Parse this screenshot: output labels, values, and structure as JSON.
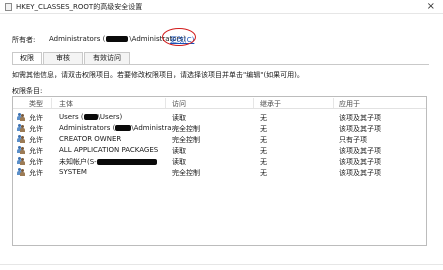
{
  "window": {
    "title": "HKEY_CLASSES_ROOT的高级安全设置",
    "close_glyph": "×"
  },
  "owner": {
    "label": "所有者:",
    "value_prefix": "Administrators (",
    "value_suffix": "\\Administrators)",
    "change_link": "更改(C)"
  },
  "tabs": [
    {
      "label": "权限",
      "active": true
    },
    {
      "label": "审核",
      "active": false
    },
    {
      "label": "有效访问",
      "active": false
    }
  ],
  "info_text": "如需其他信息，请双击权限项目。若要修改权限项目，请选择该项目并单击\"编辑\"(如果可用)。",
  "entries_label": "权限条目:",
  "columns": {
    "type": "类型",
    "principal": "主体",
    "access": "访问",
    "inherited_from": "继承于",
    "applies_to": "应用于"
  },
  "rows": [
    {
      "type": "允许",
      "principal": "Users (",
      "access": "读取",
      "inherited_from": "无",
      "applies_to": "该项及其子项"
    },
    {
      "type": "允许",
      "principal": "Administrators (",
      "access": "完全控制",
      "inherited_from": "无",
      "applies_to": "该项及其子项"
    },
    {
      "type": "允许",
      "principal": "CREATOR OWNER",
      "access": "完全控制",
      "inherited_from": "无",
      "applies_to": "只有子项"
    },
    {
      "type": "允许",
      "principal": "ALL APPLICATION PACKAGES",
      "access": "读取",
      "inherited_from": "无",
      "applies_to": "该项及其子项"
    },
    {
      "type": "允许",
      "principal": "未知帐户(S-",
      "access": "读取",
      "inherited_from": "无",
      "applies_to": "该项及其子项"
    },
    {
      "type": "允许",
      "principal": "SYSTEM",
      "access": "完全控制",
      "inherited_from": "无",
      "applies_to": "该项及其子项"
    }
  ],
  "row_principal_suffixes": {
    "0": "\\Users)",
    "1": "\\Administra..."
  },
  "colors": {
    "link": "#1a53b8",
    "annotation_circle": "#d21b1b",
    "redaction": "#0a0a0a"
  }
}
